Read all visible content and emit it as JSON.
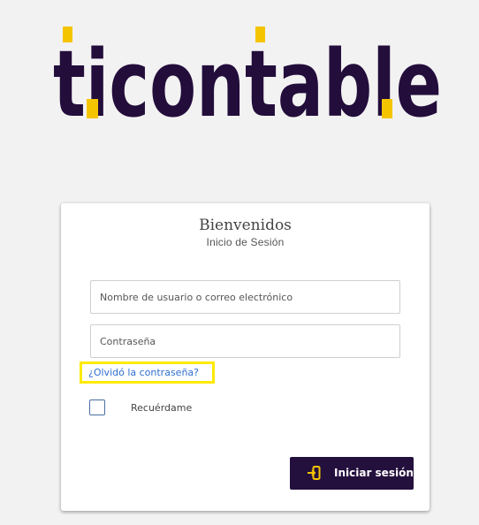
{
  "logo": {
    "text": "ticontable",
    "text_color": "#230d3b",
    "accent_color": "#f5c400"
  },
  "login": {
    "title": "Bienvenidos",
    "subtitle": "Inicio de Sesión",
    "username_placeholder": "Nombre de usuario o correo electrónico",
    "password_placeholder": "Contraseña",
    "forgot_password": "¿Olvidó la contraseña?",
    "remember_me": "Recuérdame",
    "remember_checked": false,
    "submit_label": "Iniciar sesión",
    "button_icon": "sign-in-icon",
    "button_color": "#24103d",
    "highlight_color": "#ffea00",
    "link_color": "#2f6fcf"
  }
}
